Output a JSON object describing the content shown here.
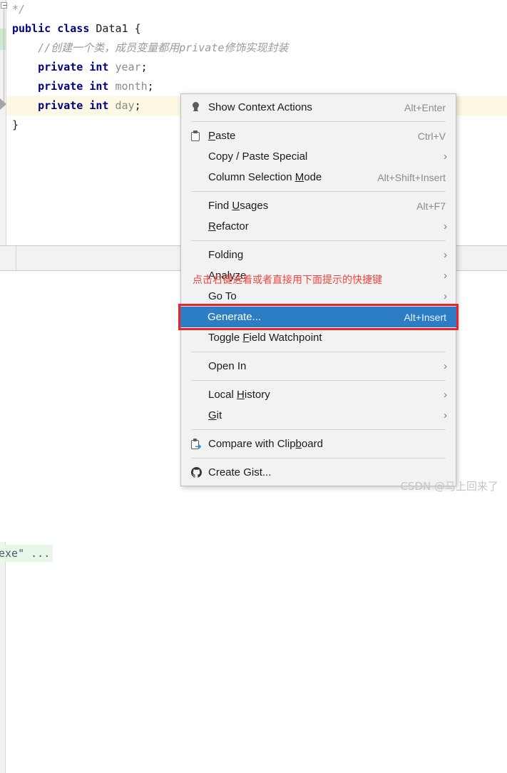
{
  "editor": {
    "lines": [
      {
        "id": "line-comment-end",
        "tokens": [
          {
            "t": "*/",
            "c": "cmt"
          }
        ],
        "indent": 0,
        "highlight": false,
        "partial": true
      },
      {
        "id": "line-class-decl",
        "indent": 0,
        "highlight": false,
        "tokens": [
          {
            "t": "public",
            "c": "kw"
          },
          {
            "t": " ",
            "c": "plain"
          },
          {
            "t": "class",
            "c": "kw"
          },
          {
            "t": " ",
            "c": "plain"
          },
          {
            "t": "Data1",
            "c": "plain"
          },
          {
            "t": " ",
            "c": "plain"
          },
          {
            "t": "{",
            "c": "brace"
          }
        ]
      },
      {
        "id": "line-comment",
        "indent": 1,
        "highlight": false,
        "tokens": [
          {
            "t": "//创建一个类，成员变量都用private修饰实现封装",
            "c": "cmt"
          }
        ]
      },
      {
        "id": "line-field-year",
        "indent": 1,
        "highlight": false,
        "tokens": [
          {
            "t": "private",
            "c": "kw"
          },
          {
            "t": " ",
            "c": "plain"
          },
          {
            "t": "int",
            "c": "kw"
          },
          {
            "t": " ",
            "c": "plain"
          },
          {
            "t": "year",
            "c": "field"
          },
          {
            "t": ";",
            "c": "plain"
          }
        ]
      },
      {
        "id": "line-field-month",
        "indent": 1,
        "highlight": false,
        "tokens": [
          {
            "t": "private",
            "c": "kw"
          },
          {
            "t": " ",
            "c": "plain"
          },
          {
            "t": "int",
            "c": "kw"
          },
          {
            "t": " ",
            "c": "plain"
          },
          {
            "t": "month",
            "c": "field"
          },
          {
            "t": ";",
            "c": "plain"
          }
        ]
      },
      {
        "id": "line-field-day",
        "indent": 1,
        "highlight": true,
        "tokens": [
          {
            "t": "private",
            "c": "kw"
          },
          {
            "t": " ",
            "c": "plain"
          },
          {
            "t": "int",
            "c": "kw"
          },
          {
            "t": " ",
            "c": "plain"
          },
          {
            "t": "day",
            "c": "field"
          },
          {
            "t": ";",
            "c": "plain"
          }
        ]
      },
      {
        "id": "line-close-brace",
        "indent": 0,
        "highlight": false,
        "tokens": [
          {
            "t": "}",
            "c": "brace"
          }
        ]
      }
    ],
    "comment_text": "//创建一个类，成员变量都用private修饰实现封装",
    "class_name": "Data1",
    "fields": [
      "year",
      "month",
      "day"
    ],
    "highlighted_line": "private int day;"
  },
  "console": {
    "text": "exe\" ..."
  },
  "context_menu": {
    "groups": [
      {
        "id": "group-context-actions",
        "items": [
          {
            "id": "show-context-actions",
            "label": "Show Context Actions",
            "mnemonic": "",
            "shortcut": "Alt+Enter",
            "icon": "lightbulb-icon",
            "submenu": false,
            "selected": false
          }
        ]
      },
      {
        "id": "group-clipboard",
        "items": [
          {
            "id": "paste",
            "label": "Paste",
            "mnemonic": "P",
            "shortcut": "Ctrl+V",
            "icon": "clipboard-icon",
            "submenu": false,
            "selected": false
          },
          {
            "id": "copy-paste-special",
            "label": "Copy / Paste Special",
            "mnemonic": "",
            "shortcut": "",
            "icon": "",
            "submenu": true,
            "selected": false
          },
          {
            "id": "column-selection-mode",
            "label": "Column Selection Mode",
            "mnemonic": "M",
            "shortcut": "Alt+Shift+Insert",
            "icon": "",
            "submenu": false,
            "selected": false
          }
        ]
      },
      {
        "id": "group-navigation",
        "items": [
          {
            "id": "find-usages",
            "label": "Find Usages",
            "mnemonic": "U",
            "shortcut": "Alt+F7",
            "icon": "",
            "submenu": false,
            "selected": false
          },
          {
            "id": "refactor",
            "label": "Refactor",
            "mnemonic": "R",
            "shortcut": "",
            "icon": "",
            "submenu": true,
            "selected": false
          }
        ]
      },
      {
        "id": "group-code",
        "items": [
          {
            "id": "folding",
            "label": "Folding",
            "mnemonic": "",
            "shortcut": "",
            "icon": "",
            "submenu": true,
            "selected": false
          },
          {
            "id": "analyze",
            "label": "Analyze",
            "mnemonic": "z",
            "shortcut": "",
            "icon": "",
            "submenu": true,
            "selected": false
          },
          {
            "id": "go-to",
            "label": "Go To",
            "mnemonic": "",
            "shortcut": "",
            "icon": "",
            "submenu": true,
            "selected": false
          },
          {
            "id": "generate",
            "label": "Generate...",
            "mnemonic": "",
            "shortcut": "Alt+Insert",
            "icon": "",
            "submenu": false,
            "selected": true
          },
          {
            "id": "toggle-field-watchpoint",
            "label": "Toggle Field Watchpoint",
            "mnemonic": "F",
            "shortcut": "",
            "icon": "",
            "submenu": false,
            "selected": false
          }
        ]
      },
      {
        "id": "group-open",
        "items": [
          {
            "id": "open-in",
            "label": "Open In",
            "mnemonic": "",
            "shortcut": "",
            "icon": "",
            "submenu": true,
            "selected": false
          }
        ]
      },
      {
        "id": "group-vcs",
        "items": [
          {
            "id": "local-history",
            "label": "Local History",
            "mnemonic": "H",
            "shortcut": "",
            "icon": "",
            "submenu": true,
            "selected": false
          },
          {
            "id": "git",
            "label": "Git",
            "mnemonic": "G",
            "shortcut": "",
            "icon": "",
            "submenu": true,
            "selected": false
          }
        ]
      },
      {
        "id": "group-compare",
        "items": [
          {
            "id": "compare-with-clipboard",
            "label": "Compare with Clipboard",
            "mnemonic": "b",
            "shortcut": "",
            "icon": "compare-clipboard-icon",
            "submenu": false,
            "selected": false
          }
        ]
      },
      {
        "id": "group-gist",
        "items": [
          {
            "id": "create-gist",
            "label": "Create Gist...",
            "mnemonic": "",
            "shortcut": "",
            "icon": "github-icon",
            "submenu": false,
            "selected": false
          }
        ]
      }
    ],
    "selected_item_label": "Generate...",
    "selected_item_shortcut": "Alt+Insert",
    "highlight_color": "#2d7dc5",
    "annotation_border_color": "#ef2027"
  },
  "annotation": {
    "text": "点击右键选着或者直接用下面提示的快捷键",
    "color": "#f0453f"
  },
  "watermark": {
    "text": "CSDN @马上回来了"
  }
}
